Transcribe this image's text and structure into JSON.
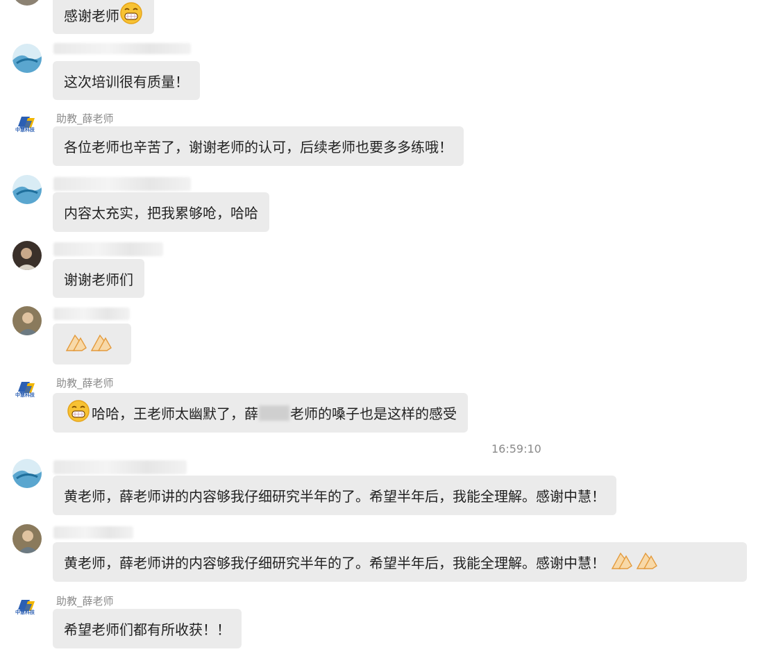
{
  "messages": [
    {
      "text": "感谢老师"
    },
    {
      "text": "这次培训很有质量！"
    },
    {
      "sender": "助教_薛老师",
      "text": "各位老师也辛苦了，谢谢老师的认可，后续老师也要多多练哦！"
    },
    {
      "text": "内容太充实，把我累够呛，哈哈"
    },
    {
      "text": "谢谢老师们"
    },
    {
      "text": ""
    },
    {
      "sender": "助教_薛老师",
      "text_a": "哈哈，王老师太幽默了，薛",
      "text_b": "老师的嗓子也是这样的感受"
    },
    {
      "text": "黄老师，薛老师讲的内容够我仔细研究半年的了。希望半年后，我能全理解。感谢中慧！"
    },
    {
      "text": "黄老师，薛老师讲的内容够我仔细研究半年的了。希望半年后，我能全理解。感谢中慧！"
    },
    {
      "sender": "助教_薛老师",
      "text": "希望老师们都有所收获！！"
    }
  ],
  "timestamp": "16:59:10",
  "brand_logo_text": "中慧科技",
  "colors": {
    "bubble": "#ebebeb",
    "text": "#222222",
    "meta": "#8a8a8a",
    "logo_blue": "#2b5fb3",
    "logo_yellow": "#f2b600"
  }
}
